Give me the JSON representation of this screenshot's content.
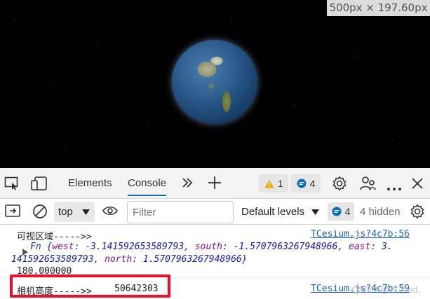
{
  "viewport": {
    "size_badge": "500px × 197.60px"
  },
  "devtools": {
    "tabs": [
      {
        "label": "Elements"
      },
      {
        "label": "Console"
      }
    ],
    "warnings_count": "1",
    "messages_count": "4"
  },
  "toolbar": {
    "context": "top",
    "filter_placeholder": "Filter",
    "levels_label": "Default levels",
    "issues_count": "4",
    "hidden_label": "4 hidden"
  },
  "console": {
    "line1_text": "可视区域----->>",
    "line1_source": "TCesium.js?4c7b:56",
    "rect_prefix": "Fn {",
    "rect_west_key": "west",
    "rect_west_val": "-3.141592653589793",
    "rect_south_key": "south",
    "rect_south_val": "-1.5707963267948966",
    "rect_east_key": "east",
    "rect_east_val": "3.",
    "rect_cont": "141592653589793",
    "rect_north_key": "north",
    "rect_north_val": "1.5707963267948966",
    "rect_suffix": "}",
    "line_value": "180.000000",
    "line2_text": "相机高度----->>",
    "line2_value": "50642303",
    "line2_source": "TCesium.js?4c7b:59",
    "watermark": "CSDN @戎昱ed."
  },
  "colors": {
    "accent": "#0f6cbd",
    "highlight": "#e8102a"
  }
}
